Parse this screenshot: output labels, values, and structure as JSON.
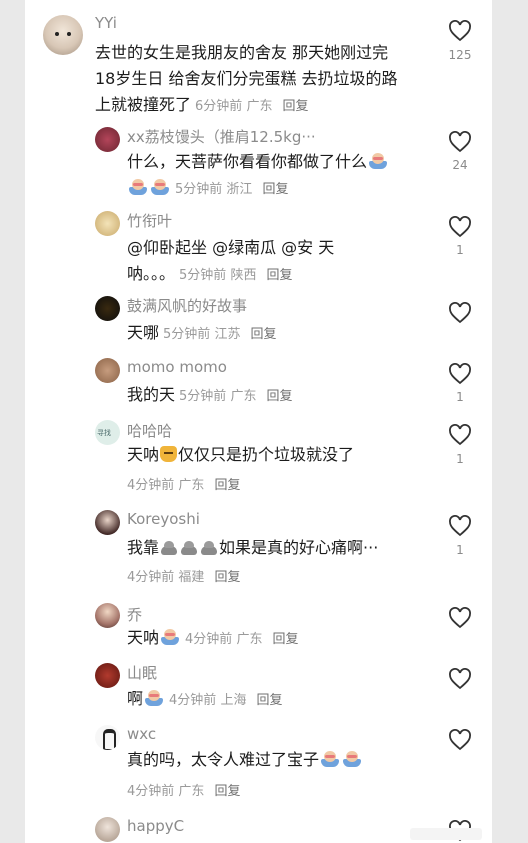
{
  "comments": [
    {
      "id": "c1",
      "user": "YYi",
      "lines": [
        "去世的女生是我朋友的舍友 那天她刚过完",
        "18岁生日 给舍友们分完蛋糕 去扔垃圾的路",
        "上就被撞死了"
      ],
      "time": "6分钟前",
      "location": "广东",
      "reply": "回复",
      "likes": "125"
    },
    {
      "id": "c2",
      "user": "xx荔枝馒头（推肩12.5kg···",
      "text": "什么，天菩萨你看看你都做了什么",
      "time": "5分钟前",
      "location": "浙江",
      "reply": "回复",
      "likes": "24"
    },
    {
      "id": "c3",
      "user": "竹衔叶",
      "line1": "@仰卧起坐  @绿南瓜  @安  天",
      "line2": "呐。。。",
      "time": "5分钟前",
      "location": "陕西",
      "reply": "回复",
      "likes": "1"
    },
    {
      "id": "c4",
      "user": "鼓满风帆的好故事",
      "text": "天哪",
      "time": "5分钟前",
      "location": "江苏",
      "reply": "回复",
      "likes": ""
    },
    {
      "id": "c5",
      "user": "momo momo",
      "text": "我的天",
      "time": "5分钟前",
      "location": "广东",
      "reply": "回复",
      "likes": "1"
    },
    {
      "id": "c6",
      "user": "哈哈哈",
      "text_a": "天呐",
      "text_b": "仅仅只是扔个垃圾就没了",
      "time": "4分钟前",
      "location": "广东",
      "reply": "回复",
      "likes": "1"
    },
    {
      "id": "c7",
      "user": "Koreyoshi",
      "text_a": "我靠",
      "text_b": "如果是真的好心痛啊···",
      "time": "4分钟前",
      "location": "福建",
      "reply": "回复",
      "likes": "1"
    },
    {
      "id": "c8",
      "user": "乔",
      "text": "天呐",
      "time": "4分钟前",
      "location": "广东",
      "reply": "回复",
      "likes": ""
    },
    {
      "id": "c9",
      "user": "山眠",
      "text": "啊",
      "time": "4分钟前",
      "location": "上海",
      "reply": "回复",
      "likes": ""
    },
    {
      "id": "c10",
      "user": "wxc",
      "text": "真的吗，太令人难过了宝子",
      "time": "4分钟前",
      "location": "广东",
      "reply": "回复",
      "likes": ""
    },
    {
      "id": "c11",
      "user": "happyC",
      "likes": ""
    }
  ],
  "avatar_labels": {
    "c6": "寻找"
  },
  "icons": {
    "like": "heart-outline-icon",
    "emoji_cry": "crying-face-emoji",
    "emoji_poo": "poop-emoji",
    "emoji_cat": "cat-face-emoji"
  },
  "colors": {
    "username": "#8b8b8b",
    "text": "#1c1c1c",
    "meta": "#9a9a9a",
    "reply": "#6f6f6f",
    "heart": "#333333"
  }
}
